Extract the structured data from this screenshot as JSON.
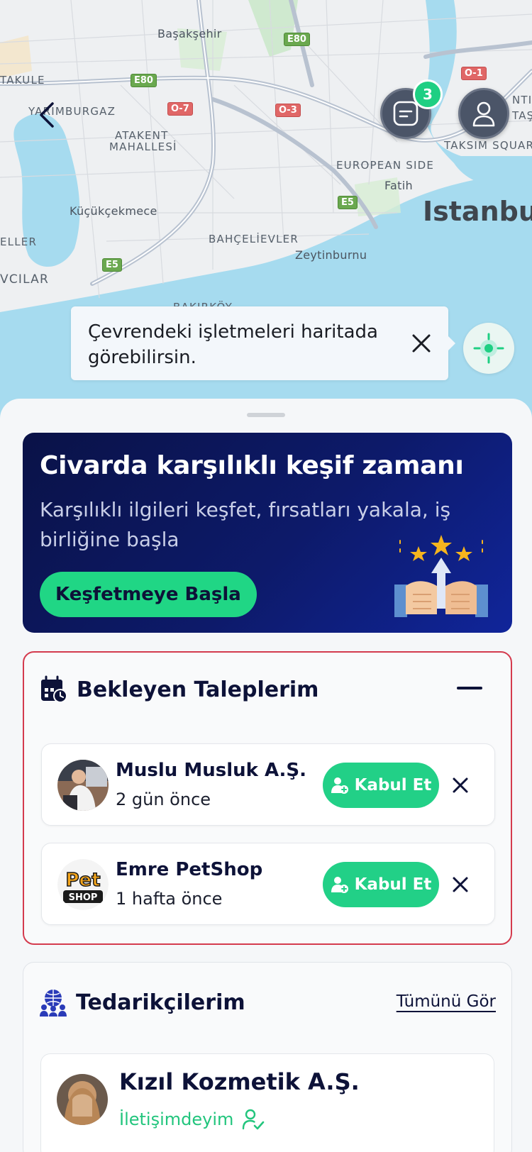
{
  "map": {
    "labels": {
      "basaksehir": "Başakşehir",
      "takule": "TAKULE",
      "yarimburgaz": "YARIMBURGAZ",
      "atakent": "ATAKENT",
      "mahallesi": "MAHALLESİ",
      "kucukcekmece": "Küçükçekmece",
      "eller": "ELLER",
      "vcilar": "VCILAR",
      "bahcelievler": "BAHÇELİEVLER",
      "zeytinburnu": "Zeytinburnu",
      "european_side": "EUROPEAN SIDE",
      "fatih": "Fatih",
      "istanbul": "Istanbul",
      "taksim_square": "TAKSIM SQUAR",
      "nti": "NTI",
      "tas": "TAŞ",
      "bakirkoy": "BAKIRKÖY"
    },
    "roads": {
      "e80_a": "E80",
      "e80_b": "E80",
      "o7": "O-7",
      "o3": "O-3",
      "o1": "O-1",
      "e5_a": "E5",
      "e5_b": "E5"
    }
  },
  "notifications": {
    "count": "3"
  },
  "tooltip": {
    "text": "Çevrendeki işletmeleri haritada görebilirsin."
  },
  "promo": {
    "title": "Civarda karşılıklı keşif zamanı",
    "subtitle": "Karşılıklı ilgileri keşfet, fırsatları yakala, iş birliğine başla",
    "cta": "Keşfetmeye Başla"
  },
  "pending": {
    "title": "Bekleyen Taleplerim",
    "items": [
      {
        "name": "Muslu Musluk A.Ş.",
        "time": "2 gün önce",
        "accept": "Kabul Et"
      },
      {
        "name": "Emre PetShop",
        "time": "1 hafta önce",
        "accept": "Kabul Et",
        "logo_top": "Pet",
        "logo_bottom": "SHOP"
      }
    ]
  },
  "suppliers": {
    "title": "Tedarikçilerim",
    "see_all": "Tümünü Gör",
    "items": [
      {
        "name": "Kızıl Kozmetik A.Ş.",
        "status": "İletişimdeyim"
      }
    ]
  },
  "colors": {
    "accent_green": "#22d087",
    "navy": "#0d1238",
    "pending_border": "#d43b4e"
  }
}
